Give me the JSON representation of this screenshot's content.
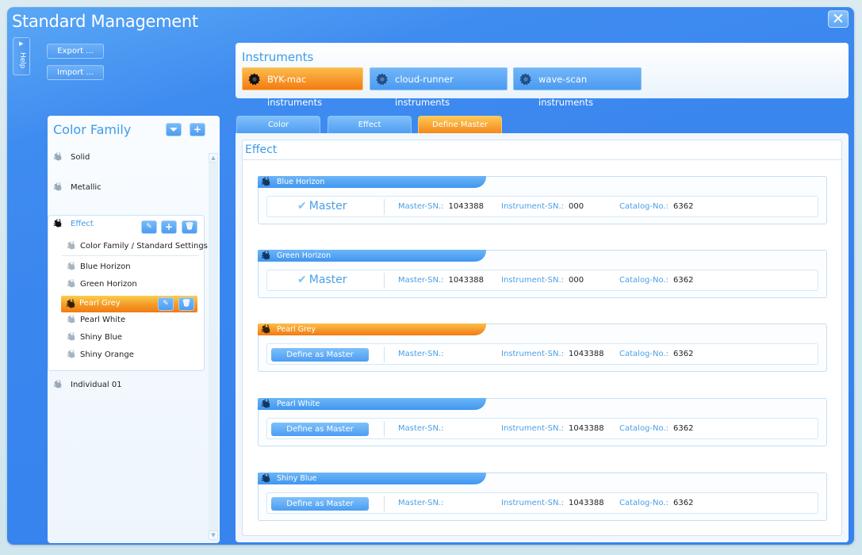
{
  "window": {
    "title": "Standard Management",
    "close_label": "✕",
    "help_label": "Help",
    "export_label": "Export ...",
    "import_label": "Import ..."
  },
  "instruments": {
    "heading": "Instruments",
    "items": [
      {
        "label": "BYK-mac instruments",
        "icon": "gear-icon",
        "active": true
      },
      {
        "label": "cloud-runner instruments",
        "icon": "gear-icon",
        "active": false
      },
      {
        "label": "wave-scan instruments",
        "icon": "gear-icon",
        "active": false
      }
    ]
  },
  "color_family": {
    "heading": "Color Family",
    "collapse_icon": "collapse-icon",
    "add_icon": "plus-icon",
    "families": [
      {
        "label": "Solid"
      },
      {
        "label": "Metallic"
      },
      {
        "label": "Effect",
        "expanded": true
      },
      {
        "label": "Individual 01"
      }
    ],
    "effect_children": [
      {
        "label": "Color Family / Standard Settings"
      },
      {
        "label": "Blue Horizon"
      },
      {
        "label": "Green Horizon"
      },
      {
        "label": "Pearl Grey",
        "selected": true
      },
      {
        "label": "Pearl White"
      },
      {
        "label": "Shiny Blue"
      },
      {
        "label": "Shiny Orange"
      }
    ]
  },
  "tabs": [
    {
      "label": "Color",
      "active": false
    },
    {
      "label": "Effect",
      "active": false
    },
    {
      "label": "Define Master",
      "active": true
    }
  ],
  "main": {
    "section_title": "Effect",
    "labels": {
      "master": "Master",
      "define_as_master": "Define as Master",
      "master_sn": "Master-SN.:",
      "instrument_sn": "Instrument-SN.:",
      "catalog_no": "Catalog-No.:"
    },
    "standards": [
      {
        "name": "Blue Horizon",
        "is_master": true,
        "master_sn": "1043388",
        "instrument_sn": "000",
        "catalog_no": "6362",
        "highlight": false
      },
      {
        "name": "Green Horizon",
        "is_master": true,
        "master_sn": "1043388",
        "instrument_sn": "000",
        "catalog_no": "6362",
        "highlight": false
      },
      {
        "name": "Pearl Grey",
        "is_master": false,
        "master_sn": "",
        "instrument_sn": "1043388",
        "catalog_no": "6362",
        "highlight": true
      },
      {
        "name": "Pearl White",
        "is_master": false,
        "master_sn": "",
        "instrument_sn": "1043388",
        "catalog_no": "6362",
        "highlight": false
      },
      {
        "name": "Shiny Blue",
        "is_master": false,
        "master_sn": "",
        "instrument_sn": "1043388",
        "catalog_no": "6362",
        "highlight": false
      }
    ]
  },
  "colors": {
    "accent_blue": "#3d9be9",
    "active_orange": "#f47a12",
    "frame_blue": "#3a86ef"
  }
}
